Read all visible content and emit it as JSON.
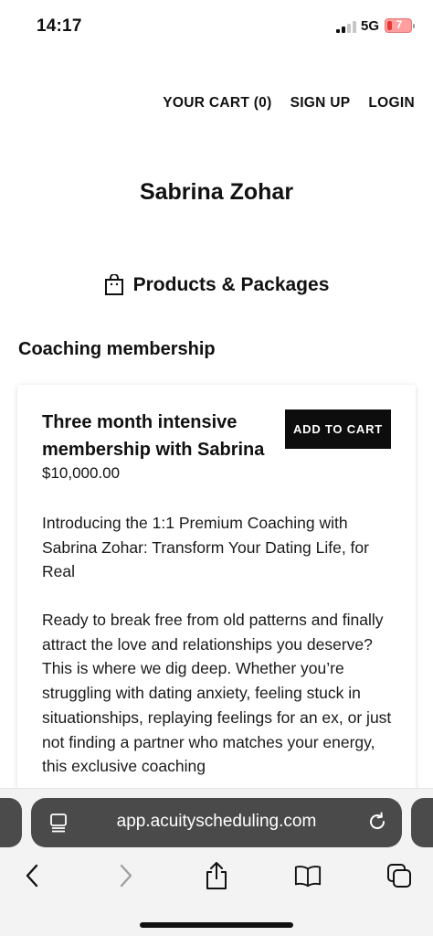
{
  "status_bar": {
    "time": "14:17",
    "network": "5G",
    "battery": "7",
    "battery_color": "#e53935"
  },
  "nav": {
    "cart": "YOUR CART (0)",
    "signup": "SIGN UP",
    "login": "LOGIN"
  },
  "owner_name": "Sabrina Zohar",
  "section": {
    "title": "Products & Packages",
    "icon": "shopping-bag-icon"
  },
  "category": "Coaching membership",
  "product": {
    "title": "Three month intensive membership with Sabrina",
    "price": "$10,000.00",
    "add_to_cart": "ADD TO CART",
    "description_1": "Introducing the 1:1 Premium Coaching with Sabrina Zohar: Transform Your Dating Life, for Real",
    "description_2": "Ready to break free from old patterns and finally attract the love and relationships you deserve? This is where we dig deep. Whether you’re struggling with dating anxiety, feeling stuck in situationships, replaying feelings for an ex, or just not finding a partner who matches your energy, this exclusive coaching"
  },
  "browser": {
    "url": "app.acuityscheduling.com",
    "icons": [
      "page-settings-icon",
      "reload-icon",
      "back-icon",
      "forward-icon",
      "share-icon",
      "bookmarks-icon",
      "tabs-icon"
    ]
  }
}
